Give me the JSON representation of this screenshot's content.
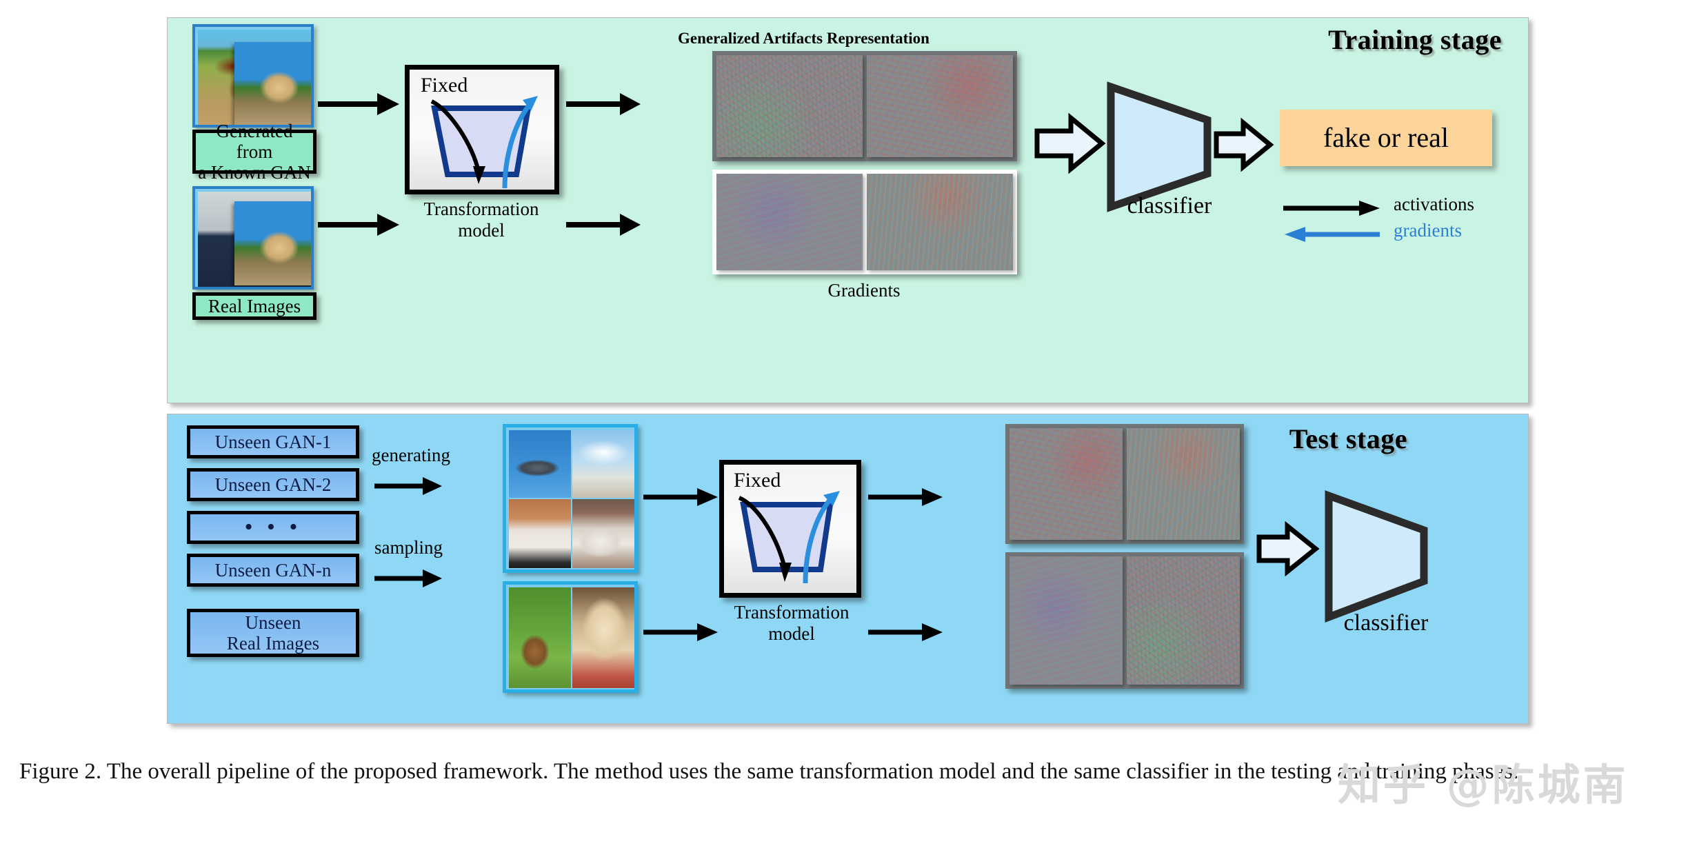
{
  "figure": {
    "caption": "Figure 2. The overall pipeline of the proposed framework. The method uses the same transformation model and the same classifier in the testing and training phases.",
    "watermark": "知乎 @陈城南"
  },
  "training_stage": {
    "title": "Training stage",
    "inputs": [
      {
        "label": "Generated from\na Known GAN"
      },
      {
        "label": "Real Images"
      }
    ],
    "model": {
      "fixed_label": "Fixed",
      "caption": "Transformation\nmodel"
    },
    "representation_title": "Generalized Artifacts Representation",
    "gradients_label": "Gradients",
    "classifier_label": "classifier",
    "output_label": "fake or real",
    "legend": [
      {
        "name": "activations",
        "color": "#000000"
      },
      {
        "name": "gradients",
        "color": "#2b7fd4"
      }
    ]
  },
  "test_stage": {
    "title": "Test stage",
    "sources": [
      {
        "label": "Unseen GAN-1"
      },
      {
        "label": "Unseen GAN-2"
      },
      {
        "label": "• • •"
      },
      {
        "label": "Unseen GAN-n"
      },
      {
        "label": "Unseen\nReal Images"
      }
    ],
    "arrow_labels": [
      {
        "label": "generating"
      },
      {
        "label": "sampling"
      }
    ],
    "model": {
      "fixed_label": "Fixed",
      "caption": "Transformation\nmodel"
    },
    "classifier_label": "classifier"
  },
  "colors": {
    "training_bg": "#c9f3e2",
    "test_bg": "#8fd8f5",
    "accent_blue": "#2b7fd4",
    "classifier_fill": "#cfeafb",
    "output_fill": "#fcd49a",
    "green_label_fill": "#8fe8c4"
  }
}
